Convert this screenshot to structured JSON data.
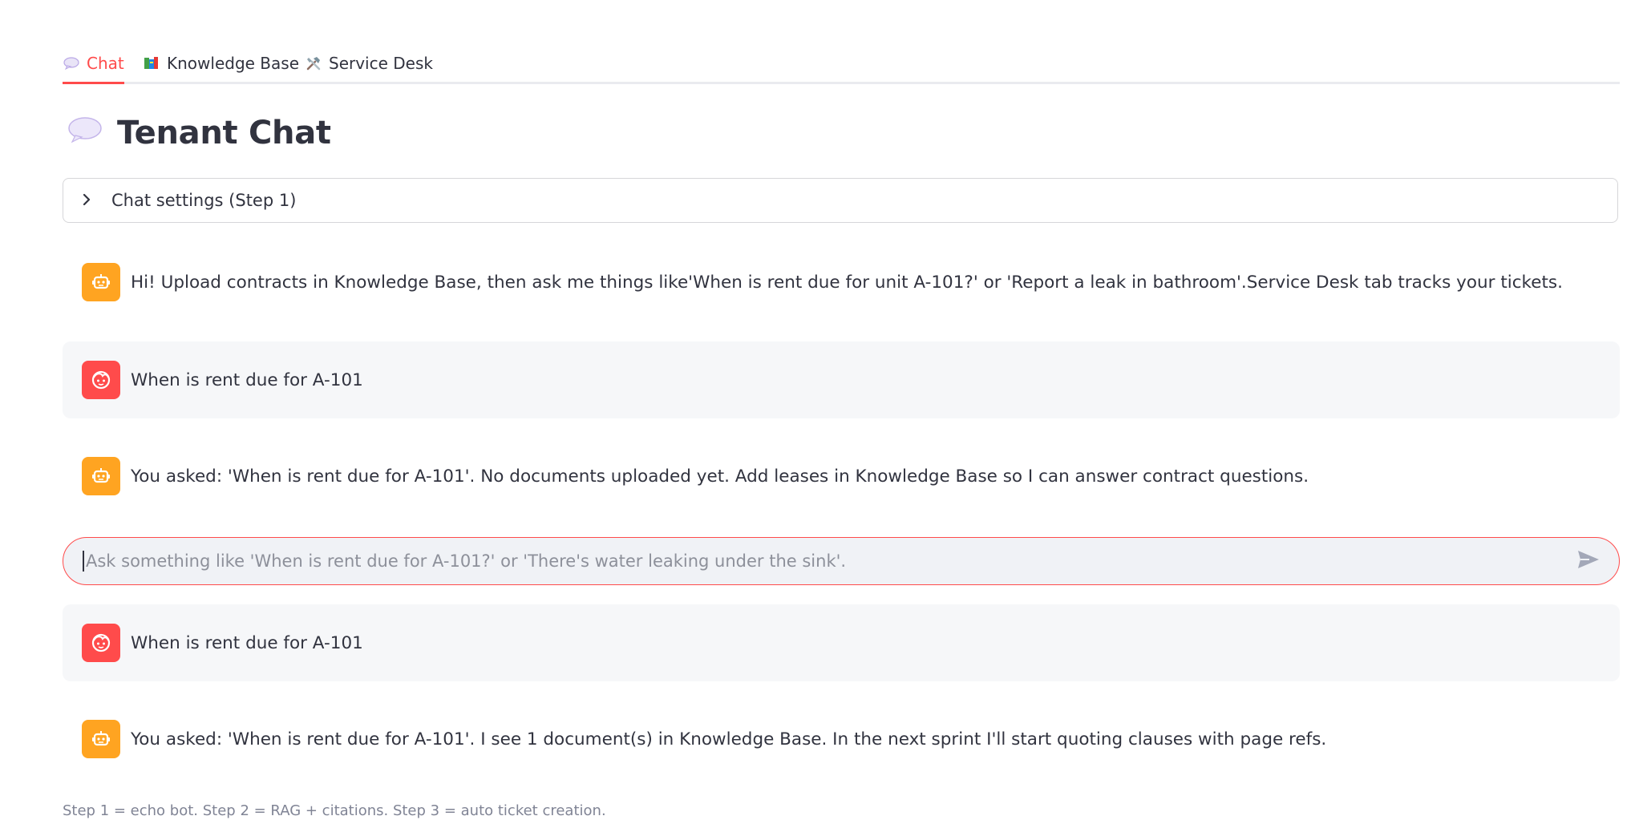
{
  "tabs": [
    {
      "label": "Chat",
      "icon": "speech-bubble-icon",
      "active": true
    },
    {
      "label": "Knowledge Base",
      "icon": "books-icon",
      "active": false
    },
    {
      "label": "Service Desk",
      "icon": "tools-icon",
      "active": false
    }
  ],
  "page": {
    "title": "Tenant Chat",
    "title_icon": "speech-bubble-icon"
  },
  "settings": {
    "label": "Chat settings (Step 1)",
    "expanded": false
  },
  "messages": [
    {
      "role": "assistant",
      "text": "Hi! Upload contracts in Knowledge Base, then ask me things like'When is rent due for unit A-101?' or 'Report a leak in bathroom'.Service Desk tab tracks your tickets."
    },
    {
      "role": "user",
      "text": "When is rent due for A-101"
    },
    {
      "role": "assistant",
      "text": "You asked: 'When is rent due for A-101'. No documents uploaded yet. Add leases in Knowledge Base so I can answer contract questions."
    },
    {
      "role": "user",
      "text": "When is rent due for A-101"
    },
    {
      "role": "assistant",
      "text": "You asked: 'When is rent due for A-101'. I see 1 document(s) in Knowledge Base. In the next sprint I'll start quoting clauses with page refs."
    }
  ],
  "chat_input": {
    "placeholder": "Ask something like 'When is rent due for A-101?' or 'There's water leaking under the sink'.",
    "value": ""
  },
  "footnote": "Step 1 = echo bot. Step 2 = RAG + citations. Step 3 = auto ticket creation.",
  "colors": {
    "accent": "#ff4b4b",
    "assistant_avatar": "#ffa421",
    "user_avatar": "#ff4b4b",
    "user_message_bg": "#f6f7f9"
  }
}
